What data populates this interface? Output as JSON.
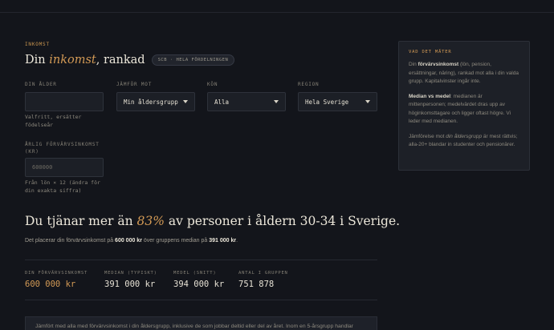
{
  "header": {
    "eyebrow": "INKOMST"
  },
  "title": {
    "prefix": "Din ",
    "accent": "inkomst",
    "suffix": ", rankad"
  },
  "badge": "SCB · HELA FÖRDELNINGEN",
  "form": {
    "age": {
      "label": "DIN ÅLDER",
      "value": "",
      "hint": "Valfritt, ersätter\nfödelseår"
    },
    "compare": {
      "label": "JÄMFÖR MOT",
      "value": "Min åldersgrupp"
    },
    "gender": {
      "label": "KÖN",
      "value": "Alla"
    },
    "region": {
      "label": "REGION",
      "value": "Hela Sverige"
    },
    "income": {
      "label": "ÅRLIG FÖRVÄRVSINKOMST\n(KR)",
      "value": "600000",
      "hint": "Från lön × 12 (ändra för\ndin exakta siffra)"
    }
  },
  "result": {
    "headline_prefix": "Du tjänar mer än ",
    "headline_accent": "83%",
    "headline_suffix": " av personer i åldern 30-34 i Sverige.",
    "sub_prefix": "Det placerar din förvärvsinkomst på ",
    "sub_income": "600 000 kr",
    "sub_middle": " över gruppens median på ",
    "sub_median": "391 000 kr",
    "sub_end": "."
  },
  "stats": [
    {
      "label": "DIN FÖRVÄRVSINKOMST",
      "value": "600 000 kr"
    },
    {
      "label": "MEDIAN (TYPISKT)",
      "value": "391 000 kr"
    },
    {
      "label": "MEDEL (SNITT)",
      "value": "394 000 kr"
    },
    {
      "label": "ANTAL I GRUPPEN",
      "value": "751 878"
    }
  ],
  "note": "Jämfört med alla med förvärvsinkomst i din åldersgrupp, inklusive de som jobbar deltid eller del av året. Inom en 5-årsgrupp handlar",
  "side": {
    "title": "VAD DET MÄTER",
    "p1_prefix": "Din ",
    "p1_bold": "förvärvsinkomst",
    "p1_rest": " (lön, pension, ersättningar, näring), rankad mot alla i din valda grupp. Kapitalvinster ingår inte.",
    "p2_bold": "Median vs medel",
    "p2_rest": ": medianen är mittenpersonen; medelvärdet dras upp av höginkomsttagare och ligger oftast högre. Vi leder med medianen.",
    "p3_prefix": "Jämförelse mot ",
    "p3_italic": "din åldersgrupp",
    "p3_rest": " är mest rättvis; alla-20+ blandar in studenter och pensionärer."
  }
}
